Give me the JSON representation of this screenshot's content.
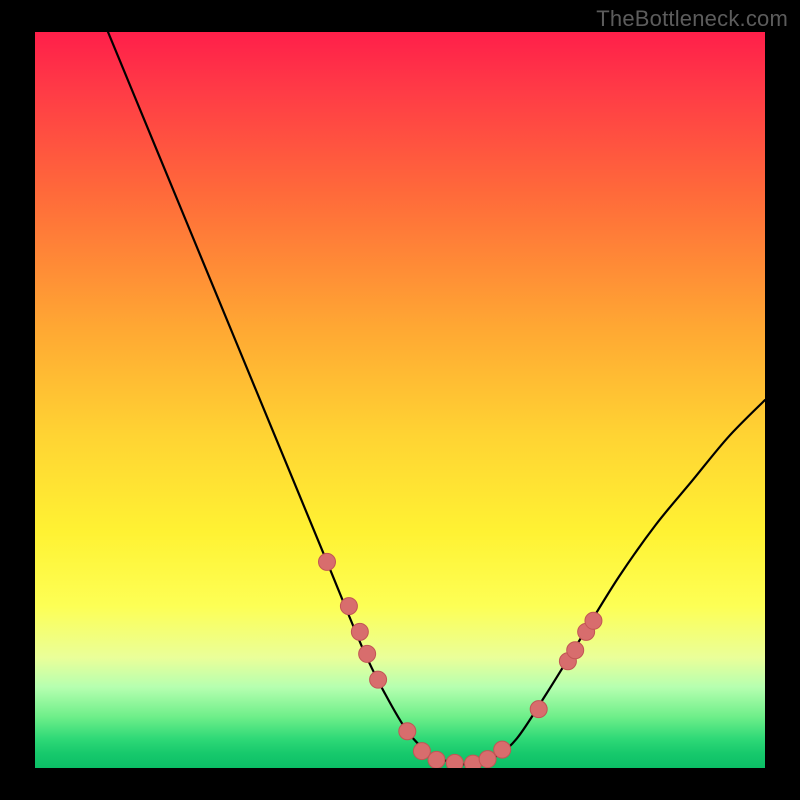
{
  "brand": "TheBottleneck.com",
  "chart_data": {
    "type": "line",
    "title": "",
    "xlabel": "",
    "ylabel": "",
    "xlim": [
      0,
      100
    ],
    "ylim": [
      0,
      100
    ],
    "series": [
      {
        "name": "curve",
        "x": [
          10,
          15,
          20,
          25,
          30,
          35,
          40,
          45,
          48,
          51,
          54,
          57,
          60,
          63,
          66,
          70,
          75,
          80,
          85,
          90,
          95,
          100
        ],
        "y": [
          100,
          88,
          76,
          64,
          52,
          40,
          28,
          16,
          10,
          5,
          2,
          0.8,
          0.5,
          1.5,
          4,
          10,
          18,
          26,
          33,
          39,
          45,
          50
        ]
      }
    ],
    "markers": [
      {
        "x": 40,
        "y": 28
      },
      {
        "x": 43,
        "y": 22
      },
      {
        "x": 44.5,
        "y": 18.5
      },
      {
        "x": 45.5,
        "y": 15.5
      },
      {
        "x": 47,
        "y": 12
      },
      {
        "x": 51,
        "y": 5
      },
      {
        "x": 53,
        "y": 2.3
      },
      {
        "x": 55,
        "y": 1.1
      },
      {
        "x": 57.5,
        "y": 0.7
      },
      {
        "x": 60,
        "y": 0.6
      },
      {
        "x": 62,
        "y": 1.2
      },
      {
        "x": 64,
        "y": 2.5
      },
      {
        "x": 69,
        "y": 8
      },
      {
        "x": 73,
        "y": 14.5
      },
      {
        "x": 74,
        "y": 16
      },
      {
        "x": 75.5,
        "y": 18.5
      },
      {
        "x": 76.5,
        "y": 20
      }
    ],
    "colors": {
      "line": "#000000",
      "marker_fill": "#d86d6d",
      "marker_stroke": "#c25555",
      "gradient_top": "#ff1f4a",
      "gradient_bottom": "#0bbf66"
    }
  }
}
